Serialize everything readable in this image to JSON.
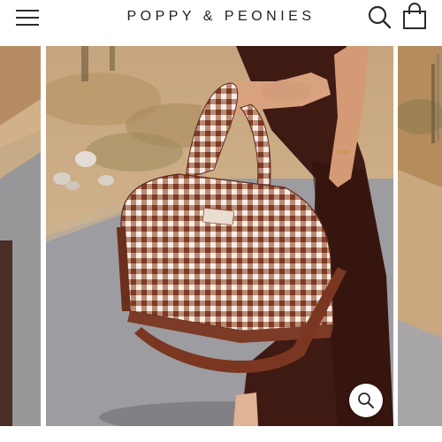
{
  "header": {
    "brand_name": "POPPY & PEONIES",
    "menu_icon": "hamburger-menu-icon",
    "search_icon": "search-icon",
    "cart_icon": "shopping-bag-icon"
  },
  "gallery": {
    "slides": [
      {
        "name": "previous-product-image"
      },
      {
        "name": "main-product-image"
      },
      {
        "name": "next-product-image"
      }
    ],
    "zoom_icon": "zoom-icon"
  },
  "colors": {
    "text": "#222222",
    "gingham_brown": "#8a4b34",
    "dress_brown": "#3e1a12",
    "strap_brown": "#6b2f1d",
    "desert_sand": "#c9a47c",
    "road_gray": "#9a9a9d"
  }
}
